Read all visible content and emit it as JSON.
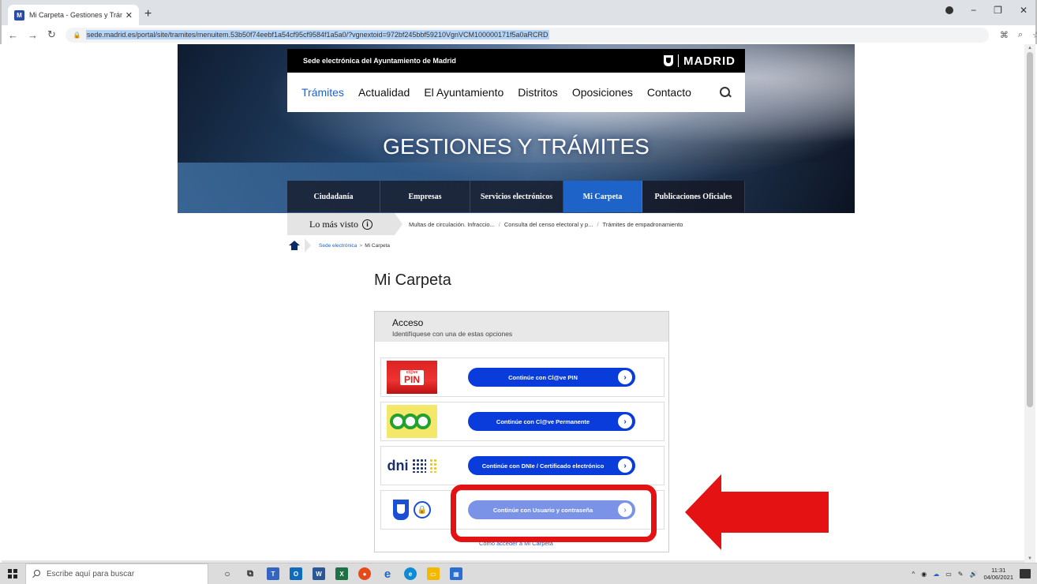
{
  "browser": {
    "tab_title": "Mi Carpeta - Gestiones y Trámite",
    "tab_close": "✕",
    "new_tab": "+",
    "url": "sede.madrid.es/portal/site/tramites/menuitem.53b50f74eebf1a54cf95cf9584f1a5a0/?vgnextoid=972bf245bbf59210VgnVCM100000171f5a0aRCRD",
    "favicon_text": "M"
  },
  "header": {
    "sede_label": "Sede electrónica del Ayuntamiento de Madrid",
    "logo_text": "MADRID"
  },
  "main_nav": {
    "items": [
      "Trámites",
      "Actualidad",
      "El Ayuntamiento",
      "Distritos",
      "Oposiciones",
      "Contacto"
    ],
    "active_index": 0
  },
  "hero": {
    "title": "GESTIONES Y TRÁMITES"
  },
  "sub_nav": {
    "items": [
      "Ciudadanía",
      "Empresas",
      "Servicios electrónicos",
      "Mi Carpeta",
      "Publicaciones Oficiales"
    ],
    "active_index": 3
  },
  "lo_mas_visto": {
    "label": "Lo más visto",
    "info_icon": "i",
    "links": [
      "Multas de circulación. Infraccio...",
      "Consulta del censo electoral y p...",
      "Trámites de empadronamiento"
    ]
  },
  "breadcrumb": {
    "home": "Sede electrónica",
    "separator": ">",
    "current": "Mi Carpeta"
  },
  "page": {
    "title": "Mi Carpeta"
  },
  "acceso": {
    "title": "Acceso",
    "subtitle": "Identifíquese con una de estas opciones",
    "options": [
      {
        "label": "Continúe con Cl@ve PIN",
        "logo": "clave-pin-logo"
      },
      {
        "label": "Continúe con Cl@ve Permanente",
        "logo": "clave-permanente-logo"
      },
      {
        "label": "Continúe con DNIe / Certificado electrónico",
        "logo": "dnie-logo"
      },
      {
        "label": "Continúe con Usuario y contraseña",
        "logo": "madrid-user-logo"
      }
    ],
    "pin_logo_small": "cl@ve",
    "pin_logo_text": "PIN",
    "dni_logo_text": "dni",
    "lock_icon": "🔒",
    "arrow_glyph": "›",
    "help_link": "Cómo acceder a Mi Carpeta"
  },
  "taskbar": {
    "search_placeholder": "Escribe aquí para buscar",
    "time": "11:31",
    "date": "04/06/2021"
  },
  "colors": {
    "accent_blue": "#1e63c8",
    "button_blue": "#0a3cdc",
    "annotation_red": "#e41212"
  }
}
